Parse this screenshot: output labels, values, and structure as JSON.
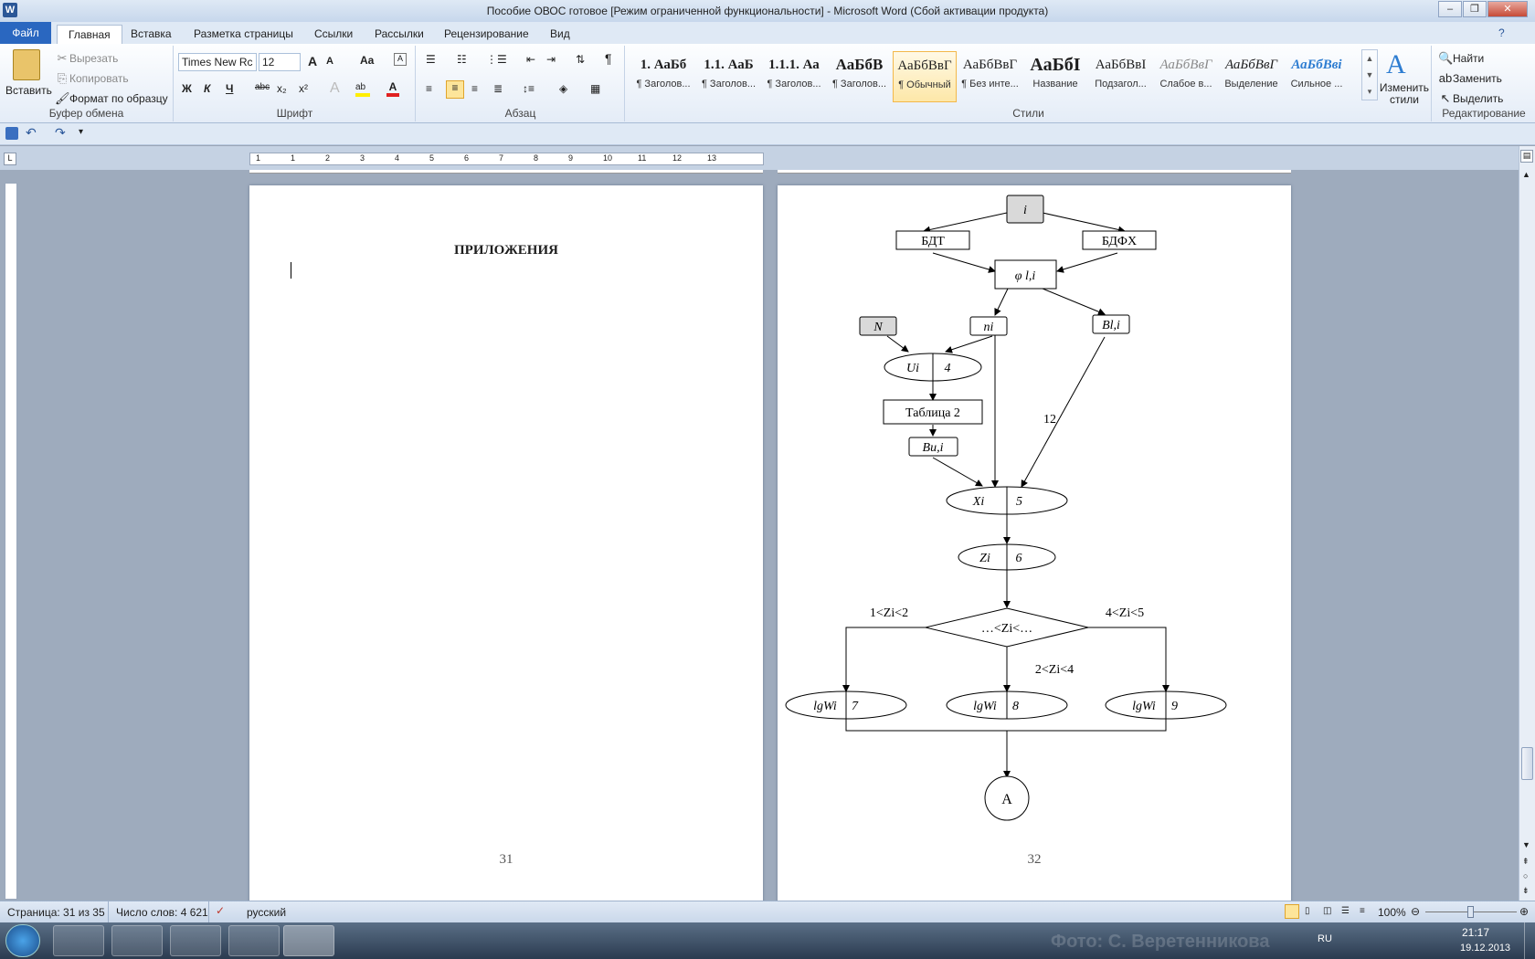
{
  "window": {
    "title": "Пособие ОВОС готовое [Режим ограниченной функциональности]  -  Microsoft Word (Сбой активации продукта)"
  },
  "tabs": [
    "Файл",
    "Главная",
    "Вставка",
    "Разметка страницы",
    "Ссылки",
    "Рассылки",
    "Рецензирование",
    "Вид"
  ],
  "clipboard": {
    "paste": "Вставить",
    "cut": "Вырезать",
    "copy": "Копировать",
    "format_painter": "Формат по образцу",
    "label": "Буфер обмена"
  },
  "font": {
    "name": "Times New Rc",
    "size": "12",
    "label": "Шрифт",
    "bold": "Ж",
    "italic": "К",
    "underline": "Ч",
    "strike": "abc",
    "sub": "x₂",
    "sup": "x²",
    "grow": "A",
    "shrink": "A",
    "case": "Aa"
  },
  "paragraph": {
    "label": "Абзац"
  },
  "styles": {
    "label": "Стили",
    "items": [
      {
        "big": "1. АаБб",
        "small": "¶ Заголов..."
      },
      {
        "big": "1.1. АаБ",
        "small": "¶ Заголов..."
      },
      {
        "big": "1.1.1. Аа",
        "small": "¶ Заголов..."
      },
      {
        "big": "АаБбВ",
        "small": "¶ Заголов..."
      },
      {
        "big": "АаБбВвГ",
        "small": "¶ Обычный"
      },
      {
        "big": "АаБбВвГ",
        "small": "¶ Без инте..."
      },
      {
        "big": "АаБбІ",
        "small": "Название"
      },
      {
        "big": "АаБбВвІ",
        "small": "Подзагол..."
      },
      {
        "big": "АаБбВвГ",
        "small": "Слабое в..."
      },
      {
        "big": "АаБбВвГ",
        "small": "Выделение"
      },
      {
        "big": "АаБбВві",
        "small": "Сильное ..."
      }
    ],
    "change": "Изменить стили"
  },
  "editing": {
    "label": "Редактирование",
    "find": "Найти",
    "replace": "Заменить",
    "select": "Выделить"
  },
  "ruler": {
    "numbers": [
      "1",
      "1",
      "2",
      "3",
      "4",
      "5",
      "6",
      "7",
      "8",
      "9",
      "10",
      "11",
      "12",
      "13"
    ]
  },
  "page31": {
    "heading": "ПРИЛОЖЕНИЯ",
    "number": "31"
  },
  "page32": {
    "number": "32",
    "diagram": {
      "i": "i",
      "bdt": "БДТ",
      "bdfx": "БДФХ",
      "phi": "φ l,i",
      "N": "N",
      "ni": "ni",
      "Bli": "Bl,i",
      "Ui": "Ui",
      "Ui_n": "4",
      "table2": "Таблица 2",
      "Bui": "Bu,i",
      "label12": "12",
      "Xi": "Xi",
      "Xi_n": "5",
      "Zi": "Zi",
      "Zi_n": "6",
      "diamond": "…<Zi<…",
      "cond_left": "1<Zi<2",
      "cond_right": "4<Zi<5",
      "cond_mid": "2<Zi<4",
      "lgW": "lgWi",
      "w1_n": "7",
      "w2_n": "8",
      "w3_n": "9",
      "A": "A"
    }
  },
  "status": {
    "page": "Страница: 31 из 35",
    "words": "Число слов: 4 621",
    "lang": "русский",
    "zoom": "100%"
  },
  "taskbar": {
    "lang": "RU",
    "time": "21:17",
    "date": "19.12.2013",
    "watermark": "Фото: С. Веретенникова"
  }
}
